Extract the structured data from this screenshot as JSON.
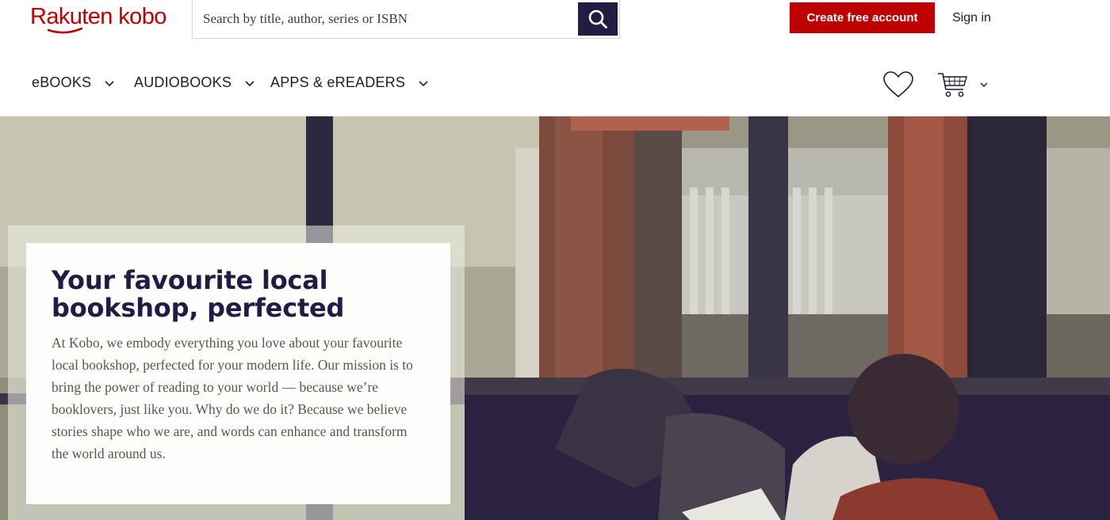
{
  "brand": {
    "name": "Rakuten kobo",
    "color": "#bf0000"
  },
  "search": {
    "placeholder": "Search by title, author, series or ISBN",
    "value": "",
    "button_icon": "search-icon"
  },
  "header": {
    "create_account_label": "Create free account",
    "signin_label": "Sign in"
  },
  "nav": {
    "items": [
      {
        "label": "eBOOKS"
      },
      {
        "label": "AUDIOBOOKS"
      },
      {
        "label": "APPS & eREADERS"
      }
    ],
    "icons": [
      "heart-icon",
      "cart-icon",
      "chevron-down-icon"
    ]
  },
  "hero": {
    "title": "Your favourite local bookshop, perfected",
    "body": "At Kobo, we embody everything you love about your favourite local bookshop, perfected for your modern life. Our mission is to bring the power of reading to your world — because we’re booklovers, just like you. Why do we do it? Because we believe stories shape who we are, and words can enhance and transform the world around us."
  },
  "colors": {
    "accent": "#bf0000",
    "navy": "#221c45",
    "text": "#1e1a3a"
  }
}
